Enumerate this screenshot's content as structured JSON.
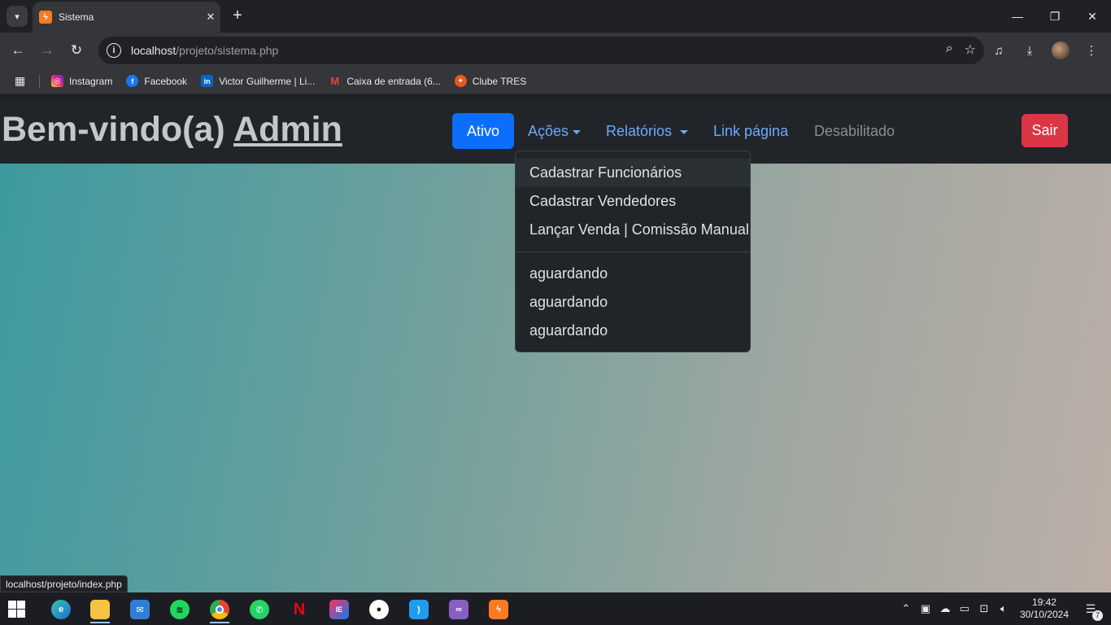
{
  "browser": {
    "tab_title": "Sistema",
    "tab_close": "✕",
    "new_tab": "+",
    "url_host": "localhost",
    "url_path": "/projeto/sistema.php",
    "bookmarks": [
      {
        "label": "Instagram",
        "color": "#d6249f"
      },
      {
        "label": "Facebook",
        "color": "#1877f2"
      },
      {
        "label": "Victor Guilherme | Li...",
        "color": "#0a66c2"
      },
      {
        "label": "Caixa de entrada (6...",
        "color": "#ea4335"
      },
      {
        "label": "Clube TRES",
        "color": "#e8581c"
      }
    ],
    "status_url": "localhost/projeto/index.php"
  },
  "navbar": {
    "greeting": "Bem-vindo(a)",
    "user": "Admin",
    "links": {
      "active": "Ativo",
      "acoes": "Ações",
      "relatorios": "Relatórios",
      "link_pagina": "Link página",
      "disabled": "Desabilitado"
    },
    "logout": "Sair"
  },
  "dropdown": {
    "items": [
      "Cadastrar Funcionários",
      "Cadastrar Vendedores",
      "Lançar Venda | Comissão Manual"
    ],
    "pending": [
      "aguardando",
      "aguardando",
      "aguardando"
    ]
  },
  "taskbar": {
    "time": "19:42",
    "date": "30/10/2024",
    "notifications": "7"
  },
  "colors": {
    "primary": "#0d6efd",
    "danger": "#dc3545",
    "navbar_bg": "#212529",
    "link": "#6ea8fe"
  }
}
